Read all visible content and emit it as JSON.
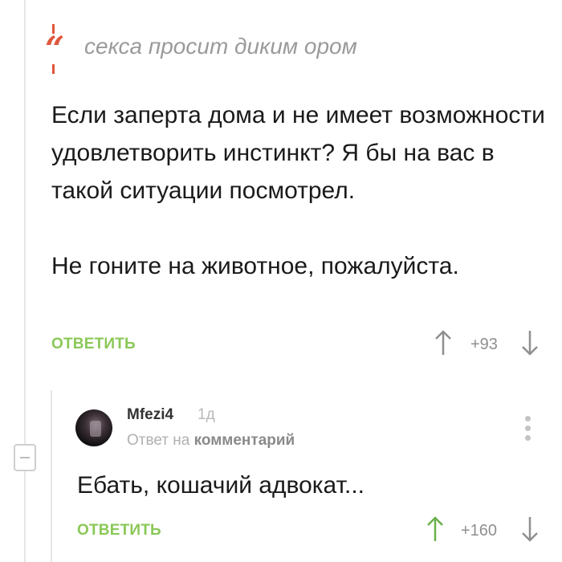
{
  "quote": {
    "text": "секса просит диким ором"
  },
  "comment": {
    "paragraphs": [
      "Если заперта дома и не имеет возможности удовлетворить инстинкт? Я бы на вас в такой ситуации посмотрел.",
      "Не гоните на животное, пожалуйста."
    ],
    "reply_label": "ОТВЕТИТЬ",
    "rating": "+93"
  },
  "reply": {
    "username": "Mfezi4",
    "age": "1д",
    "reply_prefix": "Ответ на",
    "reply_target": "комментарий",
    "text": "Ебать, кошачий адвокат...",
    "reply_label": "ОТВЕТИТЬ",
    "rating": "+160"
  },
  "colors": {
    "accent_green": "#8ac858",
    "quote_orange": "#e0573b",
    "upvote_active": "#6ab04c",
    "muted_gray": "#8f8f8f"
  },
  "icons": [
    "quote-icon",
    "up-arrow-icon",
    "down-arrow-icon",
    "more-vertical-icon",
    "collapse-icon"
  ]
}
